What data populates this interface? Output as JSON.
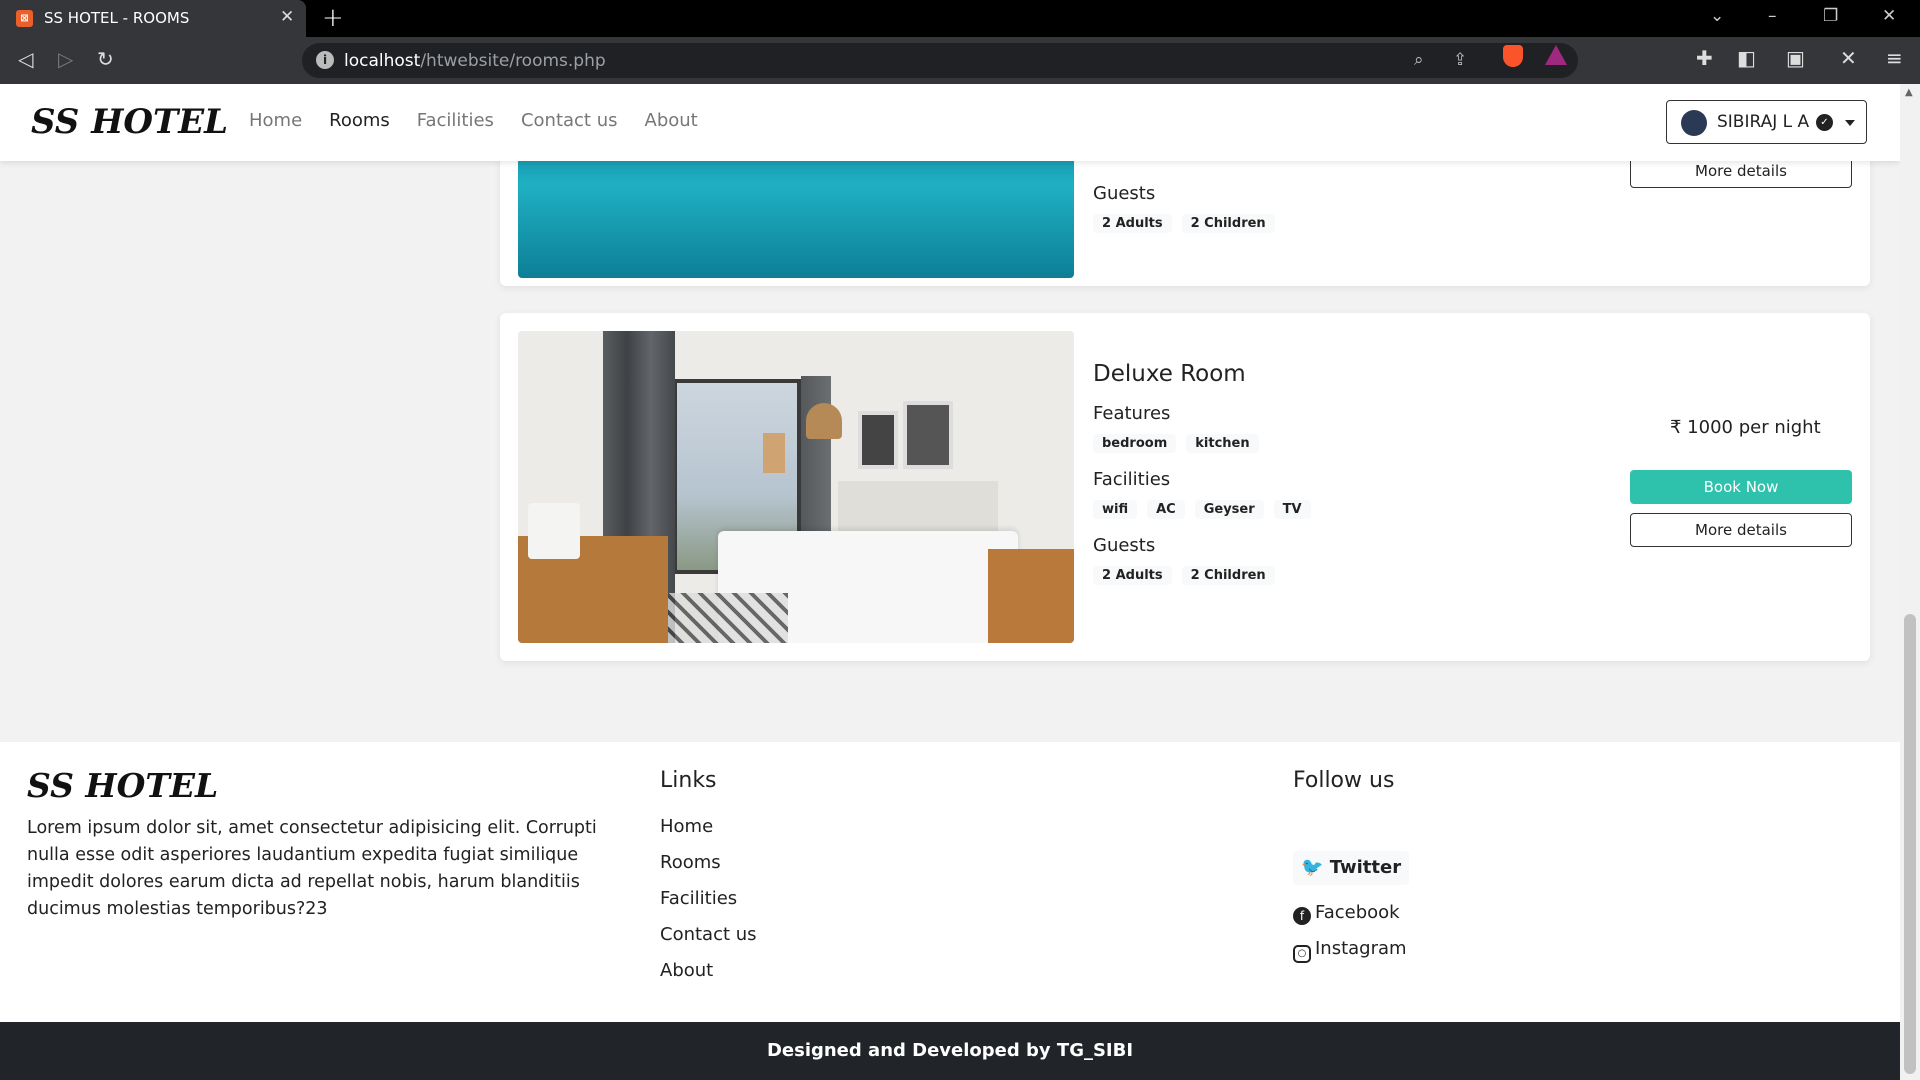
{
  "browser": {
    "tab_title": "SS HOTEL - ROOMS",
    "url_host": "localhost",
    "url_path": "/htwebsite/rooms.php"
  },
  "navbar": {
    "brand": "SS HOTEL",
    "links": [
      "Home",
      "Rooms",
      "Facilities",
      "Contact us",
      "About"
    ],
    "active_link": "Rooms",
    "user_name": "SIBIRAJ L A"
  },
  "rooms": [
    {
      "guests_title": "Guests",
      "guests": [
        "2 Adults",
        "2 Children"
      ],
      "details_label": "More details"
    },
    {
      "name": "Deluxe Room",
      "features_title": "Features",
      "features": [
        "bedroom",
        "kitchen"
      ],
      "facilities_title": "Facilities",
      "facilities": [
        "wifi",
        "AC",
        "Geyser",
        "TV"
      ],
      "guests_title": "Guests",
      "guests": [
        "2 Adults",
        "2 Children"
      ],
      "price": "₹ 1000 per night",
      "book_label": "Book Now",
      "details_label": "More details"
    }
  ],
  "footer": {
    "brand": "SS HOTEL",
    "description": "Lorem ipsum dolor sit, amet consectetur adipisicing elit. Corrupti nulla esse odit asperiores laudantium expedita fugiat similique impedit dolores earum dicta ad repellat nobis, harum blanditiis ducimus molestias temporibus?23",
    "links_title": "Links",
    "links": [
      "Home",
      "Rooms",
      "Facilities",
      "Contact us",
      "About"
    ],
    "follow_title": "Follow us",
    "twitter": "Twitter",
    "facebook": "Facebook",
    "instagram": "Instagram",
    "credit": "Designed and Developed by TG_SIBI"
  },
  "colors": {
    "accent": "#2ec1ac",
    "footer_bar": "#212529"
  }
}
